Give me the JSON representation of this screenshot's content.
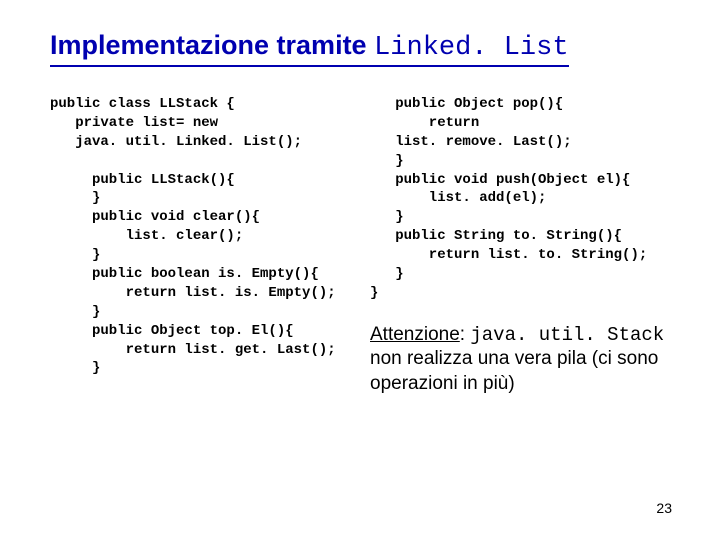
{
  "title": {
    "prefix": "Implementazione tramite ",
    "mono": "Linked. List"
  },
  "code": {
    "left": "public class LLStack {\n   private list= new\n   java. util. Linked. List();\n\n     public LLStack(){\n     }\n     public void clear(){\n         list. clear();\n     }\n     public boolean is. Empty(){\n         return list. is. Empty();\n     }\n     public Object top. El(){\n         return list. get. Last();\n     }",
    "right": "   public Object pop(){\n       return\n   list. remove. Last();\n   }\n   public void push(Object el){\n       list. add(el);\n   }\n   public String to. String(){\n       return list. to. String();\n   }\n}"
  },
  "note": {
    "underline": "Attenzione",
    "mono": "java. util. Stack",
    "rest": " non realizza una vera pila (ci sono operazioni in più)"
  },
  "page": "23"
}
